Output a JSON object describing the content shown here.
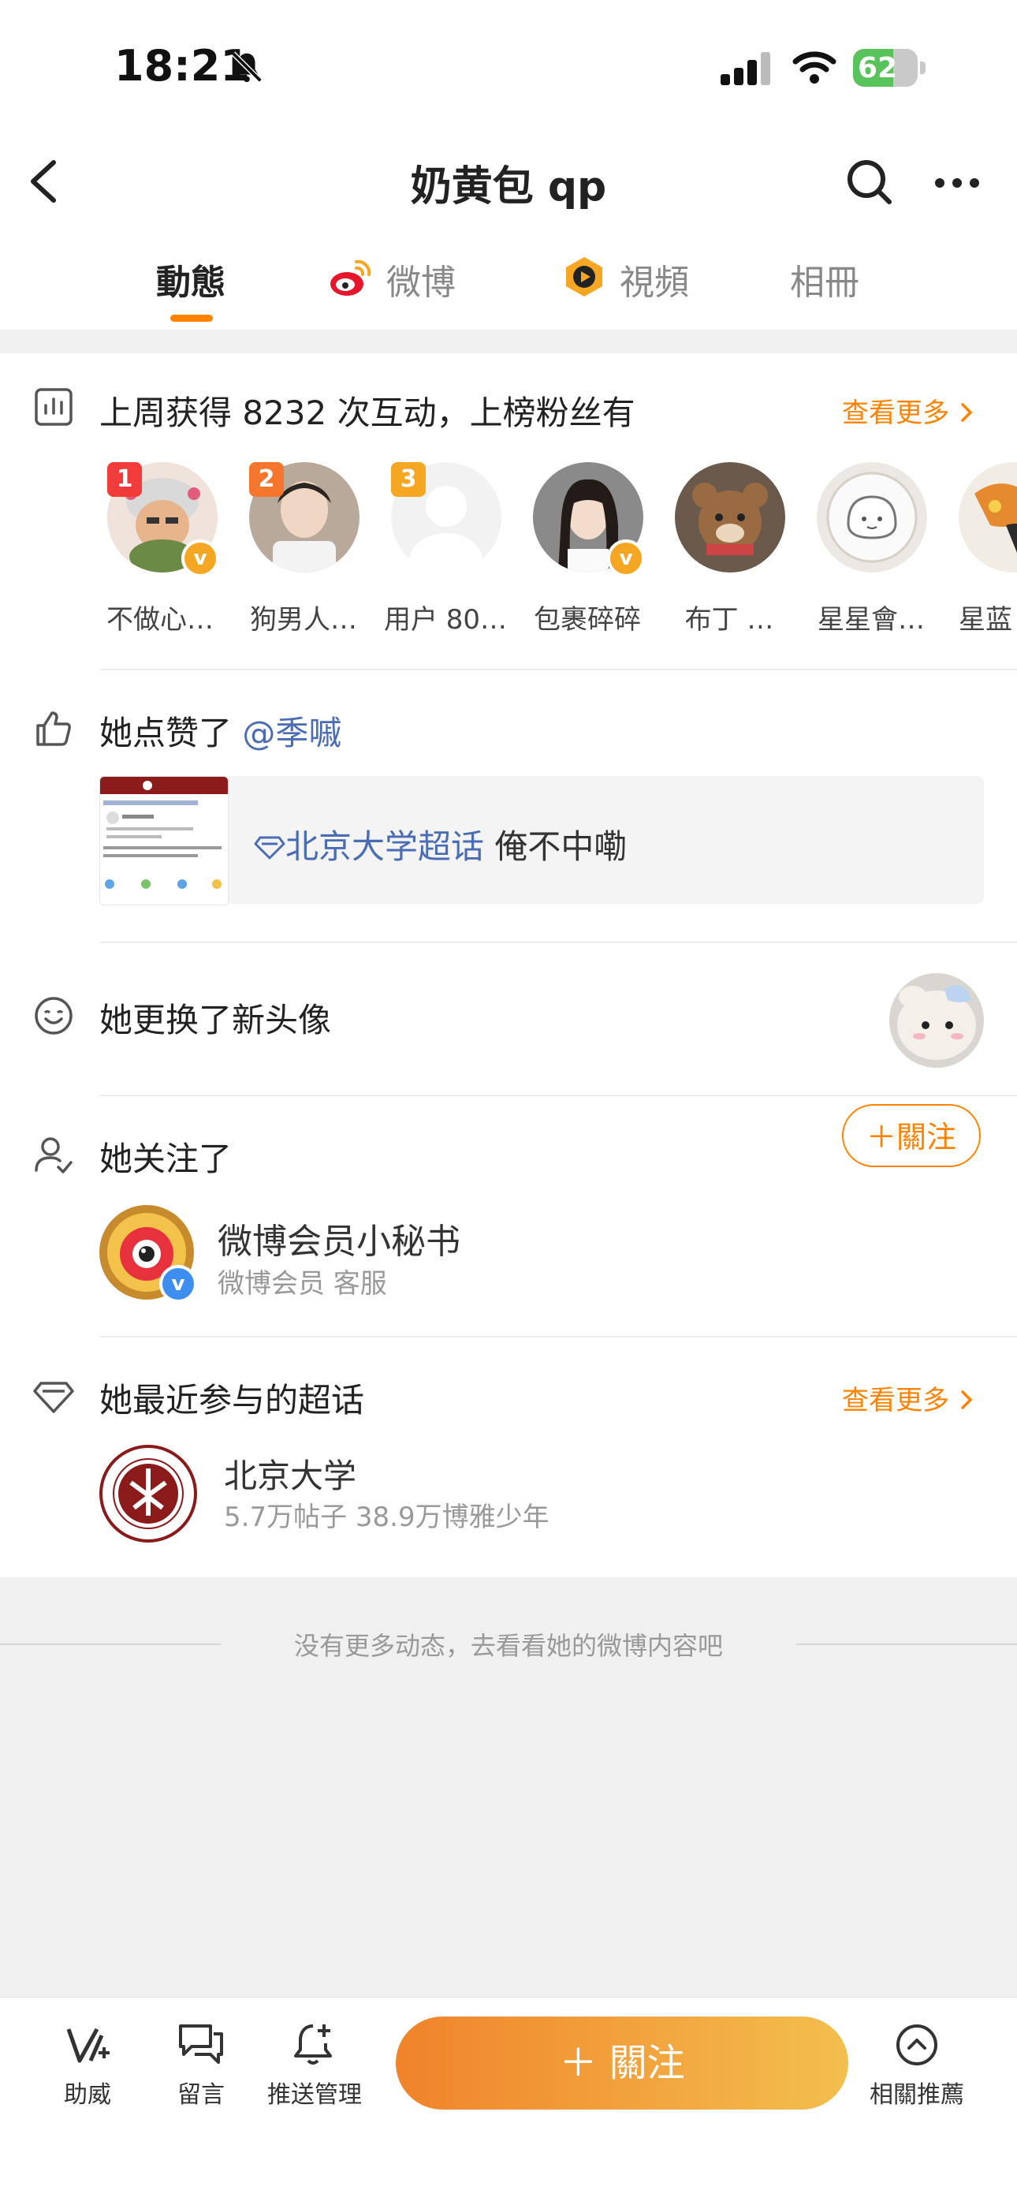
{
  "status": {
    "time": "18:21",
    "battery": "62",
    "battery_level": 0.62
  },
  "nav": {
    "title": "奶黄包 qp"
  },
  "tabs": [
    {
      "label": "動態",
      "active": true
    },
    {
      "label": "微博",
      "icon": "weibo-icon"
    },
    {
      "label": "視頻",
      "icon": "video-icon"
    },
    {
      "label": "相冊"
    }
  ],
  "interactions": {
    "title": "上周获得 8232 次互动，上榜粉丝有",
    "see_more": "查看更多",
    "fans": [
      {
        "rank": "1",
        "name": "不做心…",
        "verified": true
      },
      {
        "rank": "2",
        "name": "狗男人…"
      },
      {
        "rank": "3",
        "name": "用户 80…"
      },
      {
        "name": "包裹碎碎",
        "verified": true
      },
      {
        "name": "布丁 …"
      },
      {
        "name": "星星會…"
      },
      {
        "name": "星蓝"
      }
    ]
  },
  "liked": {
    "prefix": "她点赞了 ",
    "mention": "@季嘁",
    "topic": "北京大学超话",
    "text": " 俺不中嘞"
  },
  "avatar_change": {
    "title": "她更换了新头像"
  },
  "followed": {
    "title": "她关注了",
    "account_name": "微博会员小秘书",
    "account_desc": "微博会员 客服"
  },
  "supertopic": {
    "title": "她最近参与的超话",
    "see_more": "查看更多",
    "name": "北京大学",
    "stats": "5.7万帖子 38.9万博雅少年",
    "follow_label": "＋關注"
  },
  "end_message": "没有更多动态，去看看她的微博内容吧",
  "bottom_bar": {
    "items": [
      {
        "label": "助威"
      },
      {
        "label": "留言"
      },
      {
        "label": "推送管理"
      },
      {
        "label": "相關推薦"
      }
    ],
    "follow_label": "＋ 關注"
  },
  "colors": {
    "accent": "#ff8200",
    "link": "#4a6cb4"
  }
}
